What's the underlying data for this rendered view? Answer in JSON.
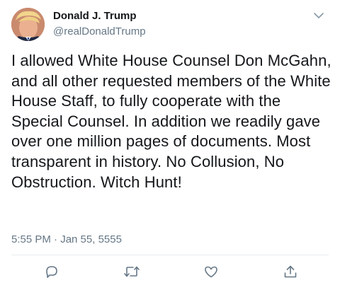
{
  "tweet": {
    "author_name": "Donald J. Trump",
    "author_handle": "@realDonaldTrump",
    "text": "I allowed White House Counsel Don McGahn, and all other requested members of the White House Staff, to fully cooperate with the Special Counsel. In addition we readily gave over one million pages of documents. Most transparent in history. No Collusion, No Obstruction. Witch Hunt!",
    "timestamp": "5:55 PM · Jan 55, 5555"
  },
  "icons": {
    "menu": "chevron-down-icon",
    "reply": "reply-icon",
    "retweet": "retweet-icon",
    "like": "heart-icon",
    "share": "share-icon"
  },
  "colors": {
    "text": "#14171a",
    "secondary": "#657786",
    "divider": "#e6ecf0"
  }
}
